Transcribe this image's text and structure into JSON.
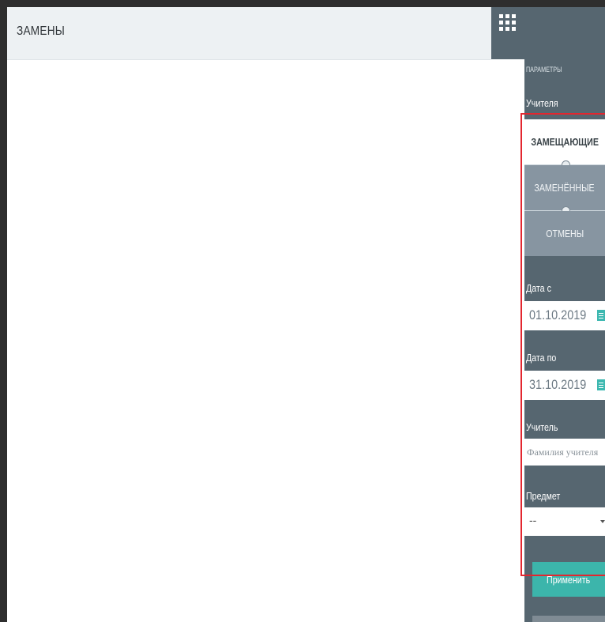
{
  "header": {
    "title": "ЗАМЕНЫ"
  },
  "panel": {
    "title": "ПАРАМЕТРЫ",
    "teachers_label": "Учителя",
    "segments": [
      {
        "label": "ЗАМЕЩАЮЩИЕ",
        "active": true
      },
      {
        "label": "ЗАМЕНЁННЫЕ",
        "active": false
      },
      {
        "label": "ОТМЕНЫ",
        "active": false
      }
    ],
    "date_from": {
      "label": "Дата с",
      "value": "01.10.2019"
    },
    "date_to": {
      "label": "Дата по",
      "value": "31.10.2019"
    },
    "teacher": {
      "label": "Учитель",
      "placeholder": "Фамилия учителя"
    },
    "subject": {
      "label": "Предмет",
      "selected": "--"
    },
    "apply_label": "Применить"
  },
  "icons": {
    "apps": "grid-icon",
    "calendar": "calendar-icon",
    "dropdown": "caret-down-icon"
  },
  "colors": {
    "panel_bg": "#566670",
    "accent": "#3cb5ab",
    "header_bg": "#edf1f3",
    "segment_inactive": "#8795a1",
    "highlight_border": "#e3262f"
  }
}
